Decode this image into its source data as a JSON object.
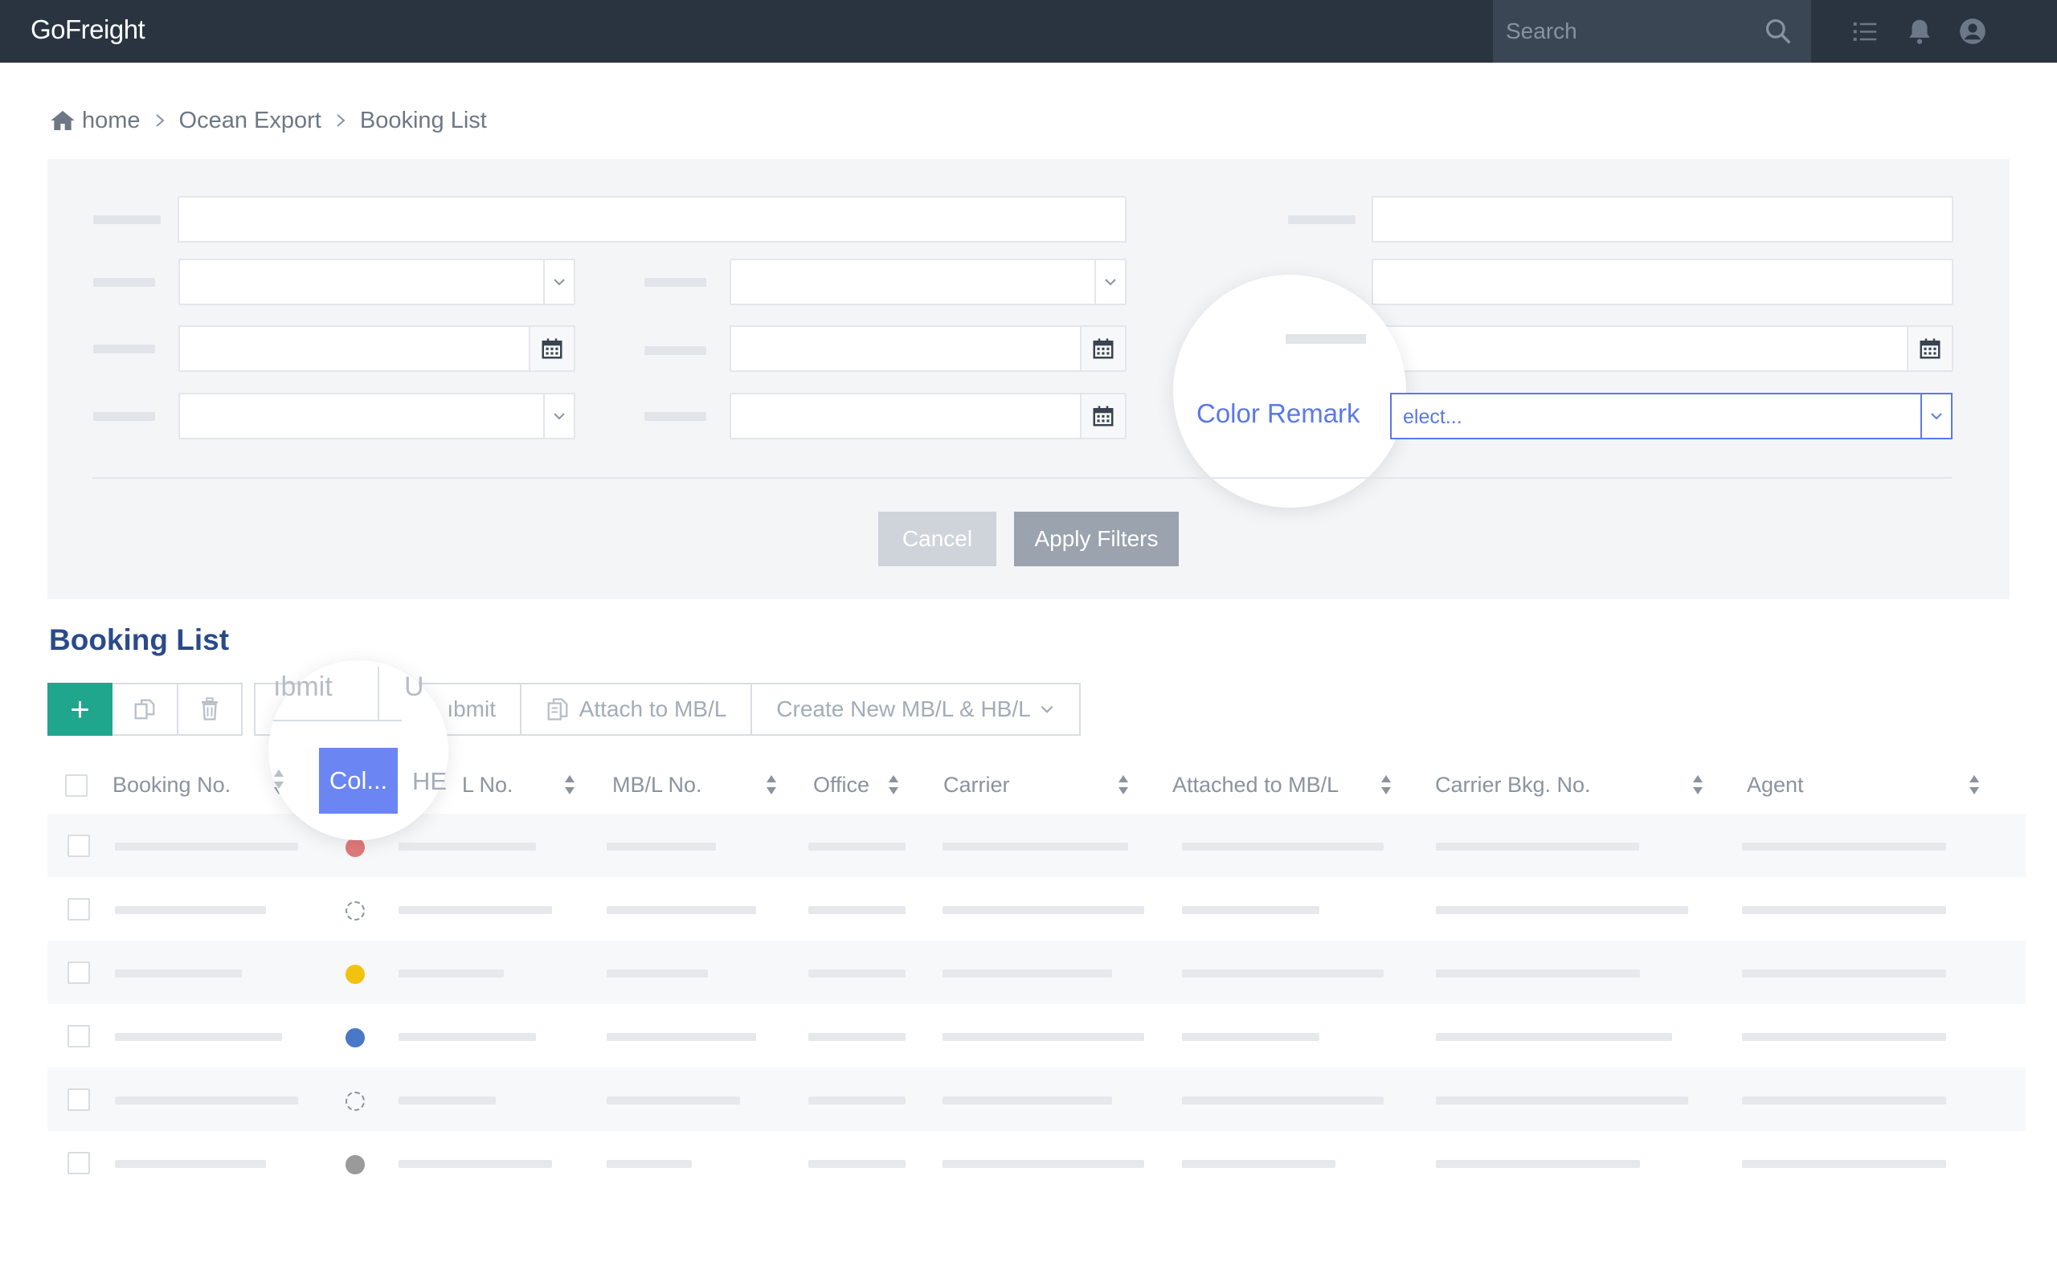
{
  "app": {
    "logo": "GoFreight",
    "search_placeholder": "Search"
  },
  "topbar": {
    "icons": [
      "search-icon",
      "list-icon",
      "bell-icon",
      "user-icon"
    ]
  },
  "breadcrumb": [
    {
      "label": "home",
      "icon": "home-icon"
    },
    {
      "label": "Ocean Export"
    },
    {
      "label": "Booking List"
    }
  ],
  "filters": {
    "color_remark_label": "Color Remark",
    "color_remark_placeholder": "Select...",
    "color_remark_visible_text": "elect...",
    "cancel_label": "Cancel",
    "apply_label": "Apply Filters"
  },
  "booking_list": {
    "title": "Booking List",
    "toolbar": {
      "add_label": "+",
      "submit_label": "Submit",
      "submit_partial": "ıbmit",
      "unsubmit_label": "Unsubmit",
      "unsubmit_partial": "ıbmit",
      "un_partial": "U",
      "attach_label": "Attach to MB/L",
      "create_label": "Create New MB/L & HB/L"
    },
    "magnified_column": "Col...",
    "magnified_hb": "HE",
    "columns": [
      {
        "key": "booking_no",
        "label": "Booking No."
      },
      {
        "key": "color",
        "label": "Col..."
      },
      {
        "key": "hbl_no",
        "label": "HB/L No.",
        "visible": "L No."
      },
      {
        "key": "mbl_no",
        "label": "MB/L No."
      },
      {
        "key": "office",
        "label": "Office"
      },
      {
        "key": "carrier",
        "label": "Carrier"
      },
      {
        "key": "attached_mbl",
        "label": "Attached to MB/L"
      },
      {
        "key": "carrier_bkg_no",
        "label": "Carrier Bkg. No."
      },
      {
        "key": "agent",
        "label": "Agent"
      }
    ],
    "rows": [
      {
        "color": "#e07a7a"
      },
      {
        "color": "none"
      },
      {
        "color": "#f2c20f"
      },
      {
        "color": "#4a78c8"
      },
      {
        "color": "none"
      },
      {
        "color": "#9a9a9a"
      }
    ]
  }
}
